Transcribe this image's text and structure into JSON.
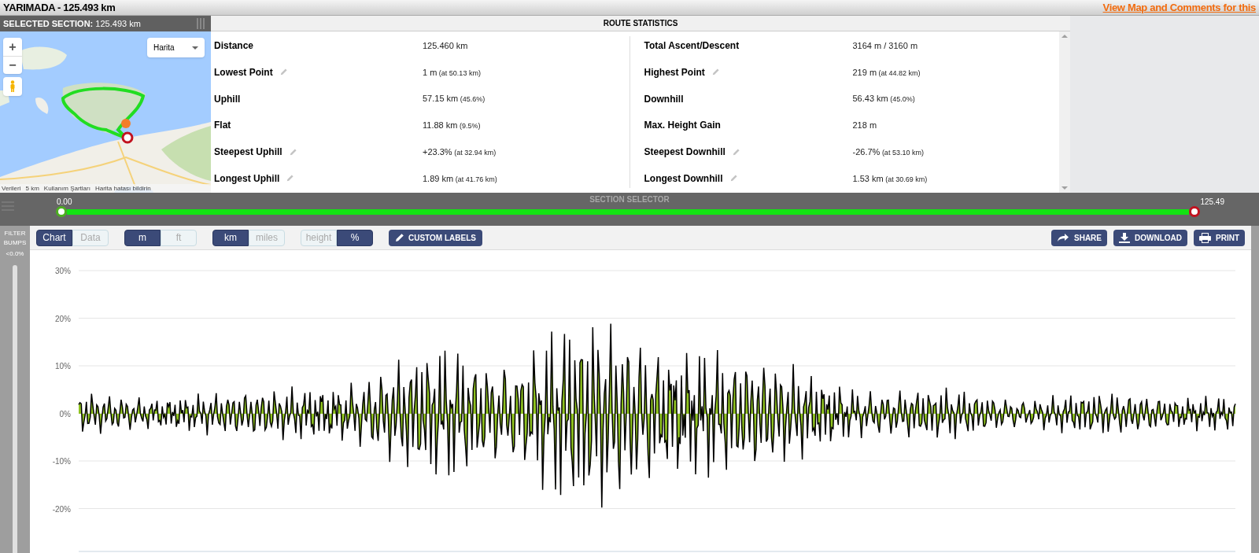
{
  "top_bar": {
    "title": "YARIMADA - 125.493 km",
    "link": "View Map and Comments for this"
  },
  "selected_section": {
    "label": "SELECTED SECTION:",
    "value": "125.493 km"
  },
  "map": {
    "map_type": "Harita",
    "zoom_in": "+",
    "zoom_out": "−",
    "attribution": [
      "Verileri",
      "5 km",
      "Kullanım Şartları",
      "Harita hatası bildirin"
    ]
  },
  "route_statistics": {
    "title": "ROUTE STATISTICS",
    "columns": [
      [
        {
          "label": "Distance",
          "value": "125.460 km",
          "editable": false
        },
        {
          "label": "Lowest Point",
          "value": "1 m",
          "note": "(at 50.13 km)",
          "editable": true
        },
        {
          "label": "Uphill",
          "value": "57.15 km",
          "note": "(45.6%)",
          "editable": false
        },
        {
          "label": "Flat",
          "value": "11.88 km",
          "note": "(9.5%)",
          "editable": false
        },
        {
          "label": "Steepest Uphill",
          "value": "+23.3%",
          "note": "(at 32.94 km)",
          "editable": true
        },
        {
          "label": "Longest Uphill",
          "value": "1.89 km",
          "note": "(at 41.76 km)",
          "editable": true
        }
      ],
      [
        {
          "label": "Total Ascent/Descent",
          "value": "3164 m / 3160 m",
          "editable": false
        },
        {
          "label": "Highest Point",
          "value": "219 m",
          "note": "(at 44.82 km)",
          "editable": true
        },
        {
          "label": "Downhill",
          "value": "56.43 km",
          "note": "(45.0%)",
          "editable": false
        },
        {
          "label": "Max. Height Gain",
          "value": "218 m",
          "editable": false
        },
        {
          "label": "Steepest Downhill",
          "value": "-26.7%",
          "note": "(at 53.10 km)",
          "editable": true
        },
        {
          "label": "Longest Downhill",
          "value": "1.53 km",
          "note": "(at 30.69 km)",
          "editable": true
        }
      ]
    ]
  },
  "section_selector": {
    "title": "SECTION SELECTOR",
    "start": "0.00",
    "end": "125.49"
  },
  "filter": {
    "label": "FILTER BUMPS",
    "value": "<0.0%"
  },
  "toggles": [
    [
      {
        "label": "Chart",
        "selected": true
      },
      {
        "label": "Data",
        "selected": false
      }
    ],
    [
      {
        "label": "m",
        "selected": true
      },
      {
        "label": "ft",
        "selected": false
      }
    ],
    [
      {
        "label": "km",
        "selected": true
      },
      {
        "label": "miles",
        "selected": false
      }
    ],
    [
      {
        "label": "height",
        "selected": false
      },
      {
        "label": "%",
        "selected": true
      }
    ]
  ],
  "custom_labels": "CUSTOM LABELS",
  "actions": [
    {
      "kind": "share",
      "label": "SHARE"
    },
    {
      "kind": "download",
      "label": "DOWNLOAD"
    },
    {
      "kind": "print",
      "label": "PRINT"
    }
  ],
  "chart": {
    "y_labels": [
      "30%",
      "20%",
      "10%",
      "0%",
      "-10%",
      "-20%"
    ]
  }
}
